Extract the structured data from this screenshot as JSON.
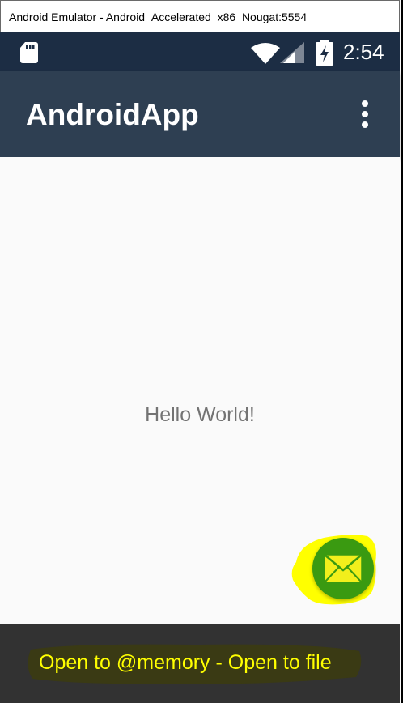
{
  "window": {
    "title": "Android Emulator - Android_Accelerated_x86_Nougat:5554"
  },
  "status_bar": {
    "time": "2:54",
    "icons": [
      "sd-card-icon",
      "wifi-icon",
      "cell-signal-icon",
      "battery-charging-icon"
    ]
  },
  "app_bar": {
    "title": "AndroidApp",
    "overflow_icon": "more-vert-icon"
  },
  "content": {
    "message": "Hello World!"
  },
  "fab": {
    "icon": "mail-icon"
  },
  "snackbar": {
    "text": "Open to @memory - Open to file"
  },
  "colors": {
    "status_bar": "#1c2d44",
    "app_bar": "#2e3f52",
    "background": "#fafafa",
    "fab": "#3a9a11",
    "highlight": "#ffff00",
    "snackbar": "#323232"
  }
}
